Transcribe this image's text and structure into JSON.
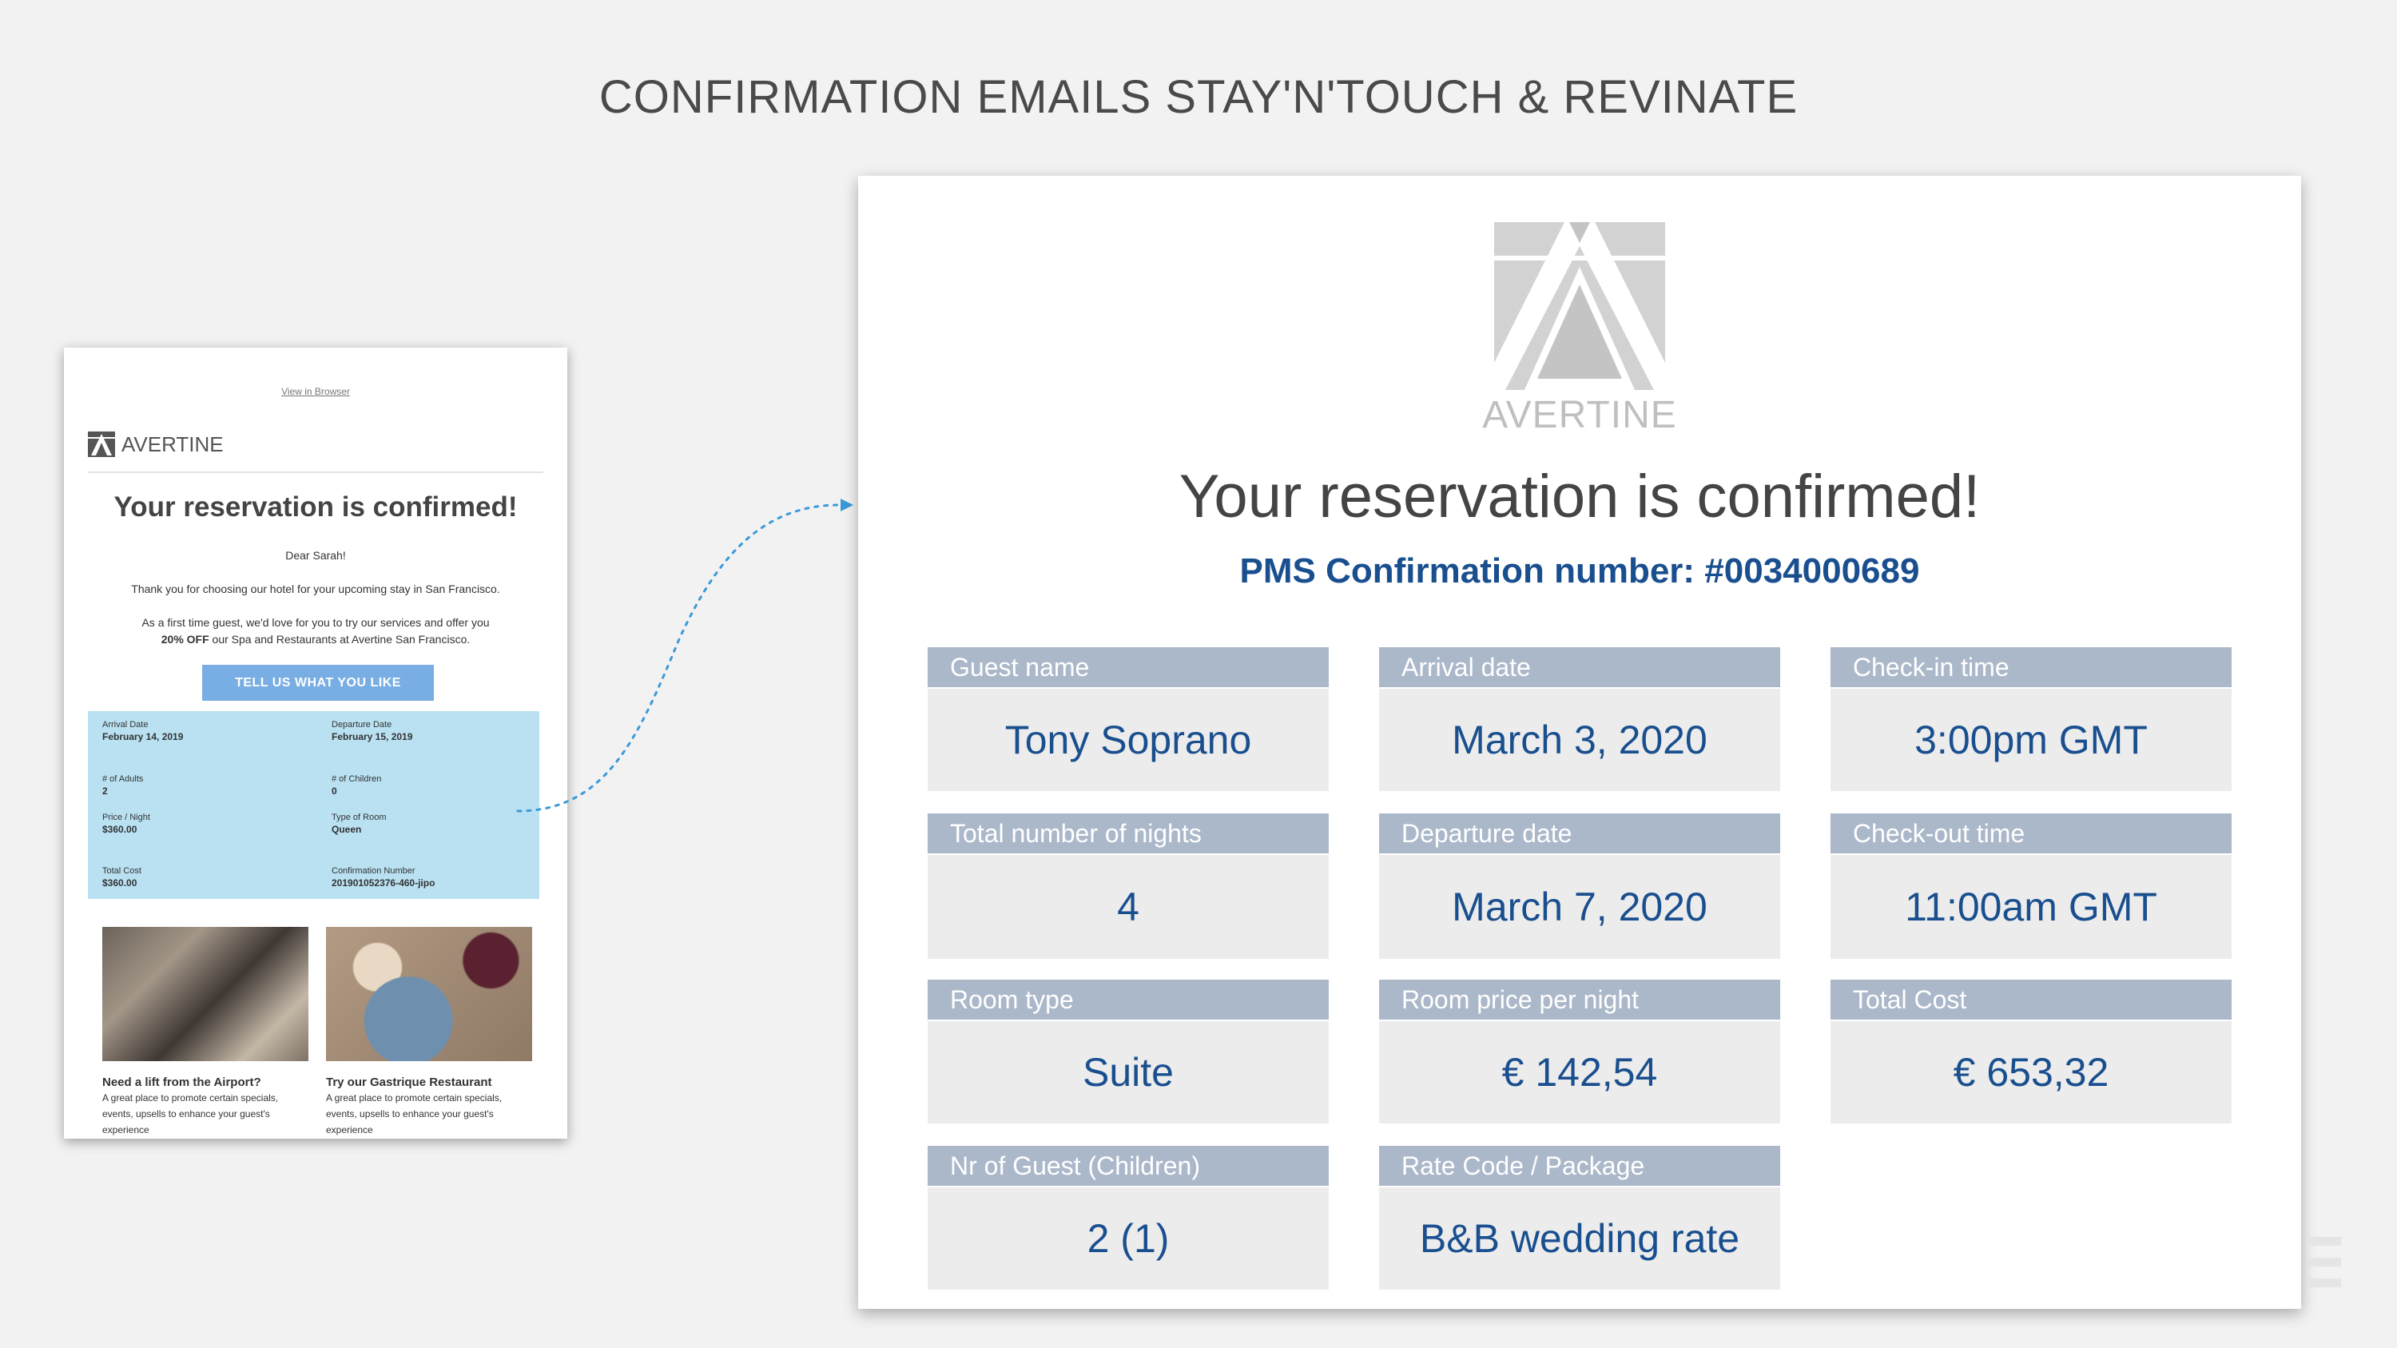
{
  "slide": {
    "title": "CONFIRMATION EMAILS STAY'N'TOUCH & REVINATE"
  },
  "thumbnail": {
    "view_link": "View in Browser",
    "brand": "AVERTINE",
    "heading": "Your reservation is confirmed!",
    "greeting": "Dear Sarah!",
    "thanks": "Thank you for choosing our hotel for your upcoming stay in San Francisco.",
    "offer_line1": "As a first time guest, we'd love for you to try our services and offer you",
    "offer_bold": "20% OFF",
    "offer_rest": " our Spa and Restaurants at Avertine San Francisco.",
    "cta": "TELL US WHAT YOU LIKE",
    "fields": [
      {
        "label": "Arrival Date",
        "value": "February 14, 2019"
      },
      {
        "label": "Departure Date",
        "value": "February 15, 2019"
      },
      {
        "label": "# of Adults",
        "value": "2"
      },
      {
        "label": "# of Children",
        "value": "0"
      },
      {
        "label": "Price / Night",
        "value": "$360.00"
      },
      {
        "label": "Type of Room",
        "value": "Queen"
      },
      {
        "label": "Total Cost",
        "value": "$360.00"
      },
      {
        "label": "Confirmation Number",
        "value": "201901052376-460-jipo"
      }
    ],
    "promos": [
      {
        "title": "Need a lift from the Airport?",
        "text": "A great place to promote certain specials, events, upsells to enhance your guest's experience"
      },
      {
        "title": "Try our Gastrique Restaurant",
        "text": "A great place to promote certain specials, events, upsells to enhance your guest's experience"
      }
    ]
  },
  "email": {
    "brand": "AVERTINE",
    "heading": "Your reservation is confirmed!",
    "confirmation": "PMS Confirmation  number: #0034000689",
    "cells": [
      {
        "label": "Guest name",
        "value": "Tony Soprano"
      },
      {
        "label": "Arrival date",
        "value": "March  3, 2020"
      },
      {
        "label": "Check-in time",
        "value": "3:00pm GMT"
      },
      {
        "label": "Total number of nights",
        "value": "4"
      },
      {
        "label": "Departure  date",
        "value": "March  7, 2020"
      },
      {
        "label": "Check-out time",
        "value": "11:00am GMT"
      },
      {
        "label": "Room type",
        "value": "Suite"
      },
      {
        "label": "Room price per night",
        "value": "€ 142,54"
      },
      {
        "label": "Total Cost",
        "value": "€ 653,32"
      },
      {
        "label": "Nr of Guest (Children)",
        "value": "2 (1)"
      },
      {
        "label": "Rate Code / Package",
        "value": "B&B wedding rate"
      }
    ]
  },
  "colors": {
    "label_bg": "#abb8ca",
    "value_bg": "#ececec",
    "value_text": "#1a4f8f",
    "thumb_box": "#b9e1f2",
    "cta": "#78aee3",
    "connector": "#3a9ad9"
  }
}
